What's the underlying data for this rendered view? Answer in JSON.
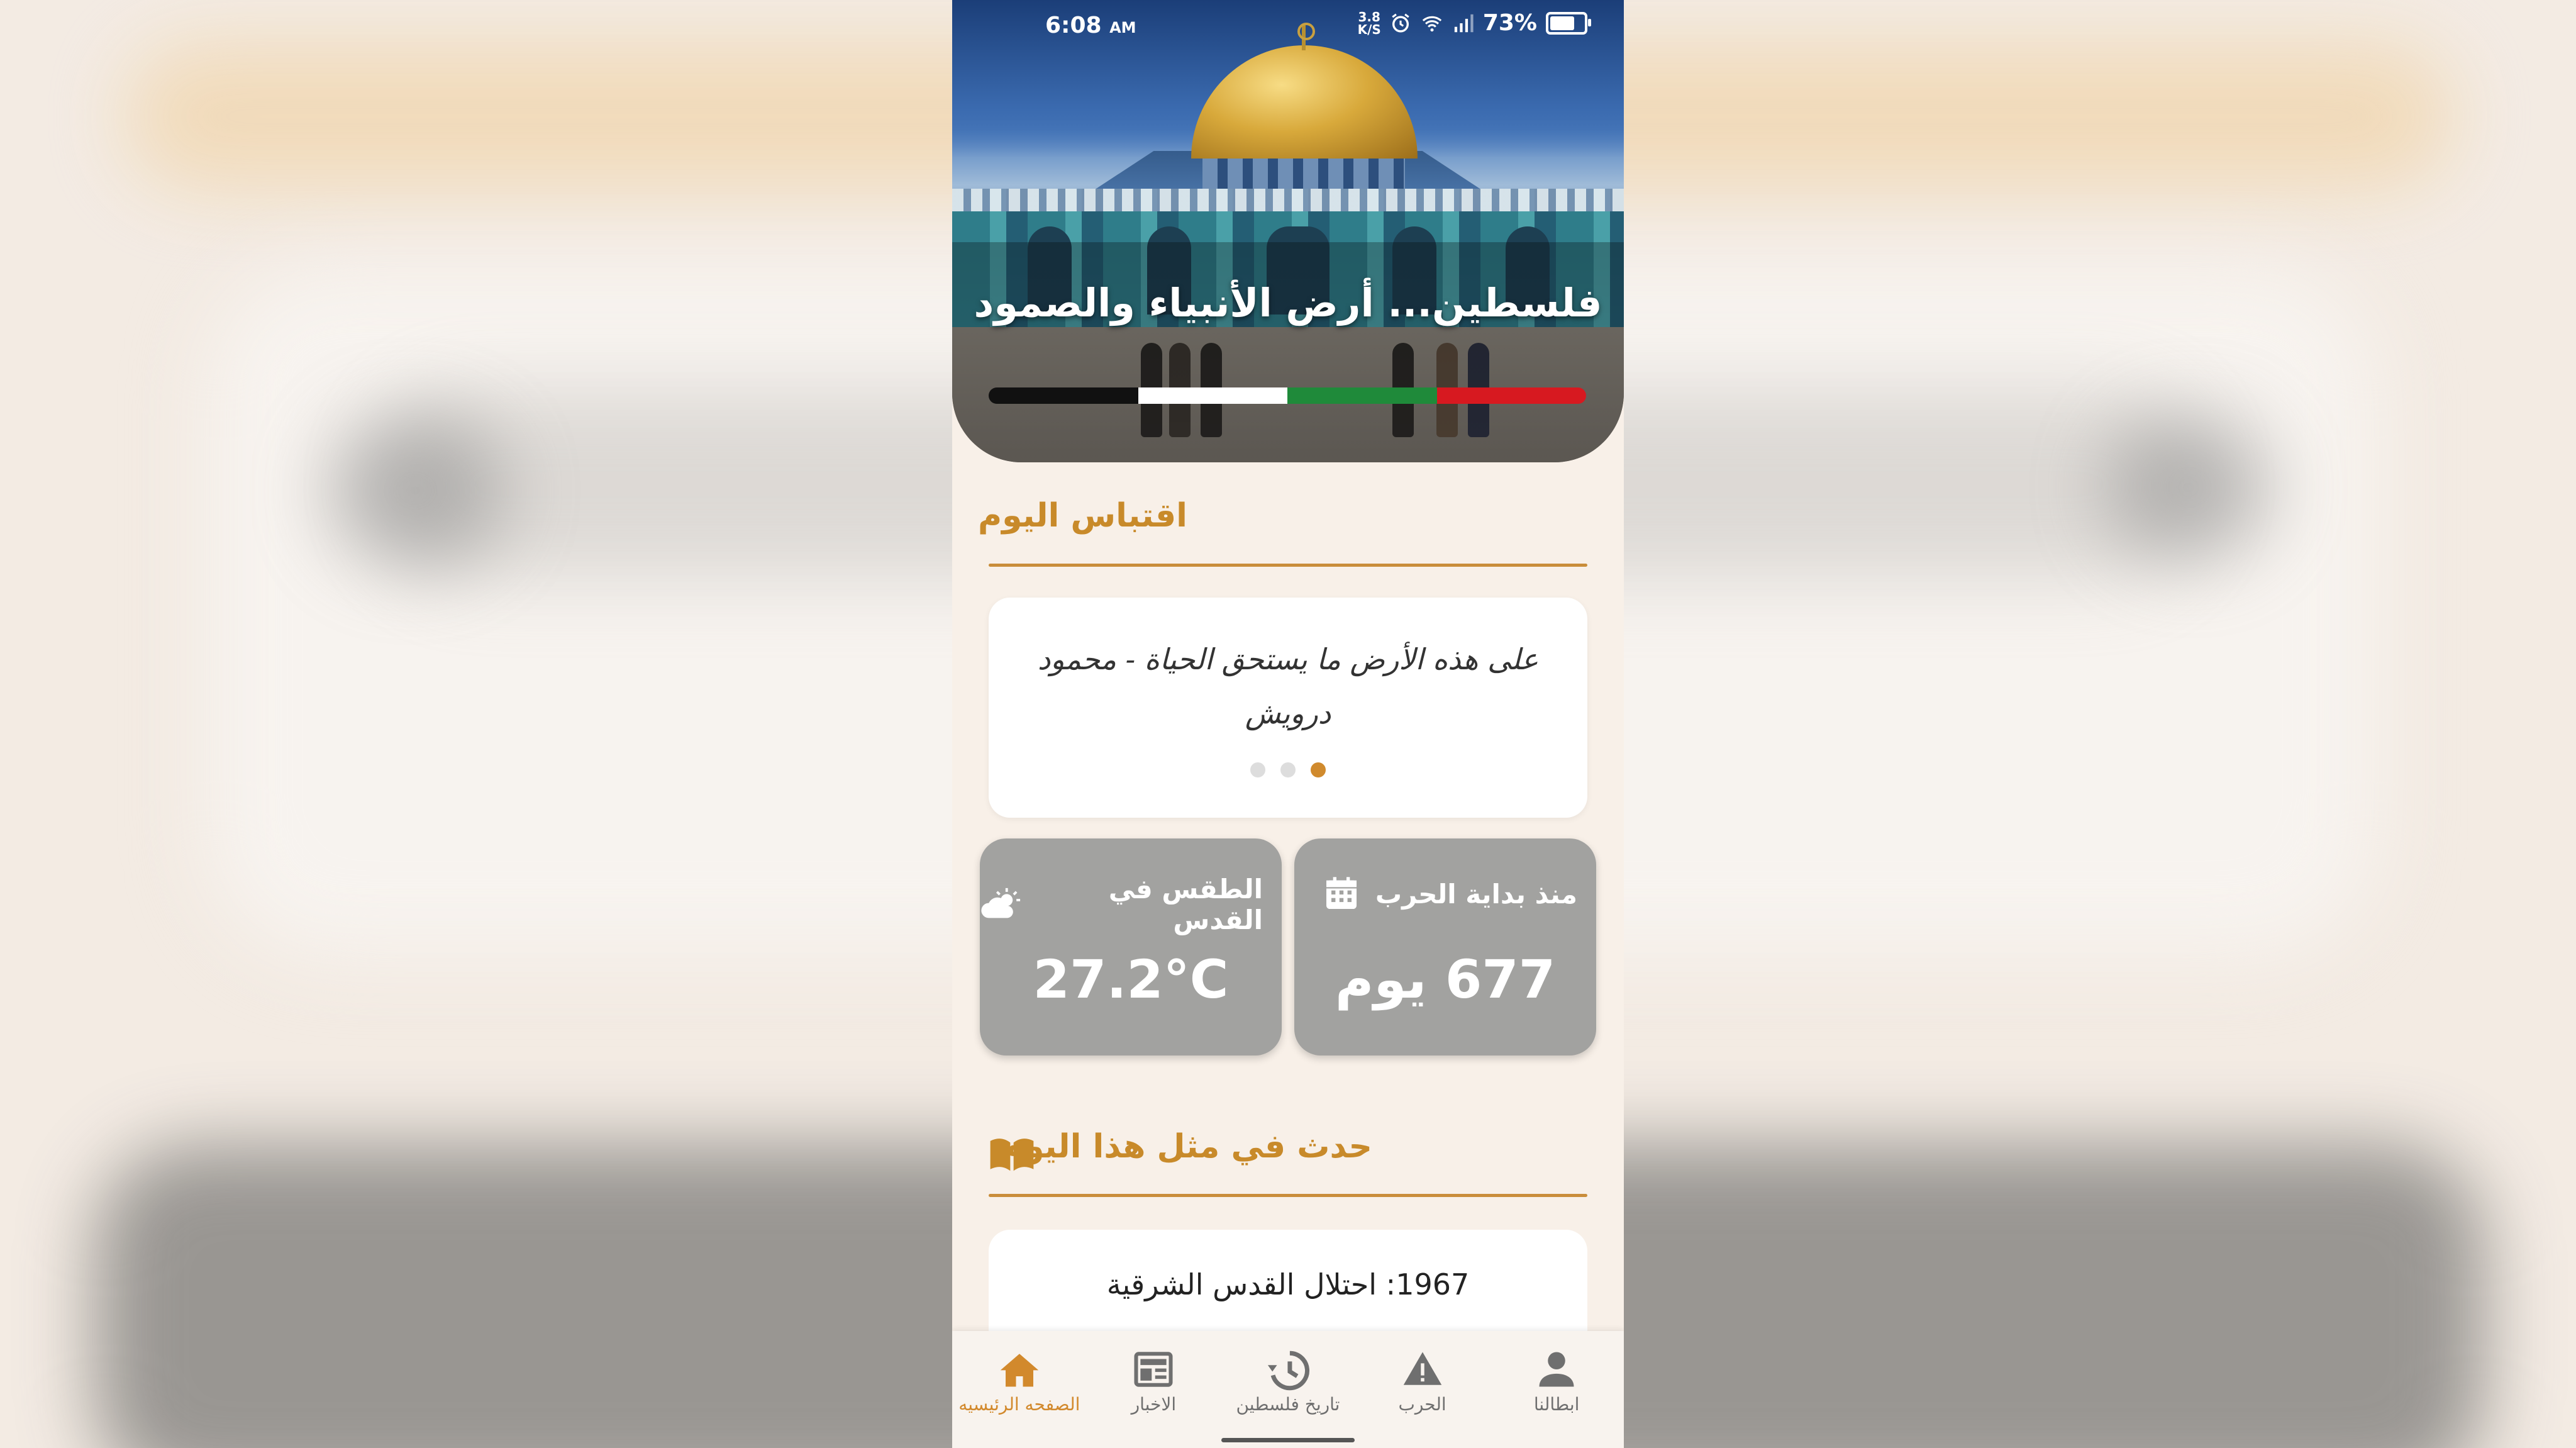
{
  "status_bar": {
    "time": "6:08",
    "ampm": "AM",
    "net_speed_value": "3.8",
    "net_speed_unit": "K/S",
    "battery": "73%",
    "battery_level": 0.73
  },
  "hero": {
    "title": "فلسطين... أرض الأنبياء والصمود",
    "flag_colors": [
      "#111111",
      "#ffffff",
      "#1f8a3a",
      "#d71920"
    ]
  },
  "quote_section": {
    "title": "اقتباس اليوم",
    "quote": "على هذه الأرض ما يستحق الحياة - محمود درويش",
    "page_count": 3,
    "active_page": 1
  },
  "stats": {
    "war": {
      "label": "منذ بداية الحرب",
      "value": "677 يوم",
      "icon": "calendar-icon"
    },
    "weather": {
      "label": "الطقس في القدس",
      "value": "27.2°C",
      "icon": "partly-cloudy-icon"
    }
  },
  "events_section": {
    "title": "حدث في مثل هذا اليوم",
    "icon": "open-book-icon",
    "first_event": "1967: احتلال القدس الشرقية"
  },
  "bottom_nav": {
    "items": [
      {
        "label": "الصفحه الرئيسيه",
        "icon": "home-icon",
        "active": true
      },
      {
        "label": "الاخبار",
        "icon": "newspaper-icon",
        "active": false
      },
      {
        "label": "تاريخ فلسطين",
        "icon": "history-icon",
        "active": false
      },
      {
        "label": "الحرب",
        "icon": "warning-icon",
        "active": false
      },
      {
        "label": "ابطالنا",
        "icon": "person-icon",
        "active": false
      }
    ]
  },
  "colors": {
    "accent": "#c88a2a",
    "card_grey": "#a2a2a0",
    "background": "#f8f0e8"
  }
}
